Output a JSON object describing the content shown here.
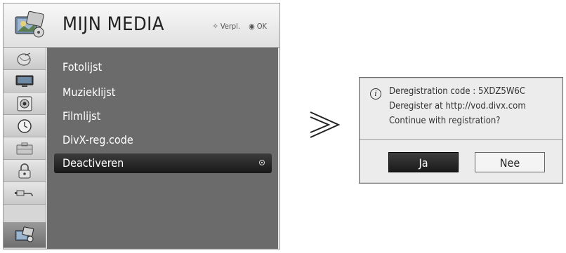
{
  "tv_menu": {
    "title": "MIJN MEDIA",
    "hint_move": "Verpl.",
    "hint_ok": "OK",
    "sidebar_icons": [
      "satellite-dish-icon",
      "monitor-icon",
      "speaker-icon",
      "clock-icon",
      "briefcase-icon",
      "lock-icon",
      "cable-icon",
      "my-media-icon"
    ],
    "items": [
      {
        "label": "Fotolijst"
      },
      {
        "label": "Muzieklijst"
      },
      {
        "label": "Filmlijst"
      },
      {
        "label": "DivX-reg.code"
      },
      {
        "label": "Deactiveren"
      }
    ],
    "selected_index": 4
  },
  "dialog": {
    "line1": "Deregistration code : 5XDZ5W6C",
    "line2": "Deregister at http://vod.divx.com",
    "line3": "Continue with registration?",
    "yes_label": "Ja",
    "no_label": "Nee"
  },
  "colors": {
    "list_bg": "#6b6b6b",
    "selected_bg": "#1c1c1c",
    "dialog_bg": "#ececec"
  }
}
